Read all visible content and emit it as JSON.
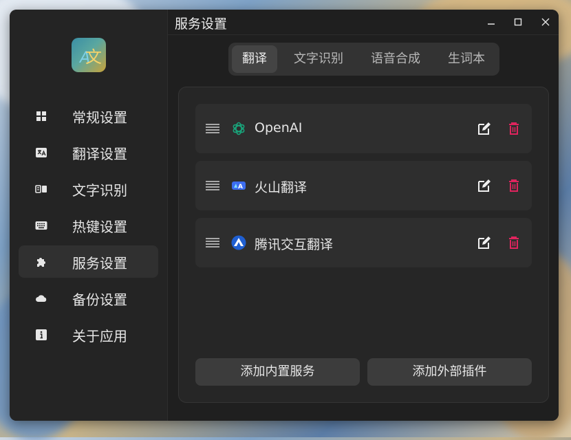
{
  "window": {
    "title": "服务设置"
  },
  "sidebar": {
    "items": [
      {
        "label": "常规设置",
        "icon": "grid-icon"
      },
      {
        "label": "翻译设置",
        "icon": "translate-icon"
      },
      {
        "label": "文字识别",
        "icon": "ocr-icon"
      },
      {
        "label": "热键设置",
        "icon": "keyboard-icon"
      },
      {
        "label": "服务设置",
        "icon": "puzzle-icon",
        "active": true
      },
      {
        "label": "备份设置",
        "icon": "cloud-icon"
      },
      {
        "label": "关于应用",
        "icon": "info-icon"
      }
    ]
  },
  "tabs": [
    {
      "label": "翻译",
      "active": true
    },
    {
      "label": "文字识别"
    },
    {
      "label": "语音合成"
    },
    {
      "label": "生词本"
    }
  ],
  "services": [
    {
      "name": "OpenAI",
      "icon": "openai-icon"
    },
    {
      "name": "火山翻译",
      "icon": "volcengine-icon"
    },
    {
      "name": "腾讯交互翻译",
      "icon": "tencent-icon"
    }
  ],
  "buttons": {
    "add_builtin": "添加内置服务",
    "add_plugin": "添加外部插件"
  },
  "colors": {
    "delete": "#e0245e",
    "openai_green": "#19a37a",
    "volc_blue": "#3c6df0",
    "tencent_blue": "#1f5fd1"
  }
}
